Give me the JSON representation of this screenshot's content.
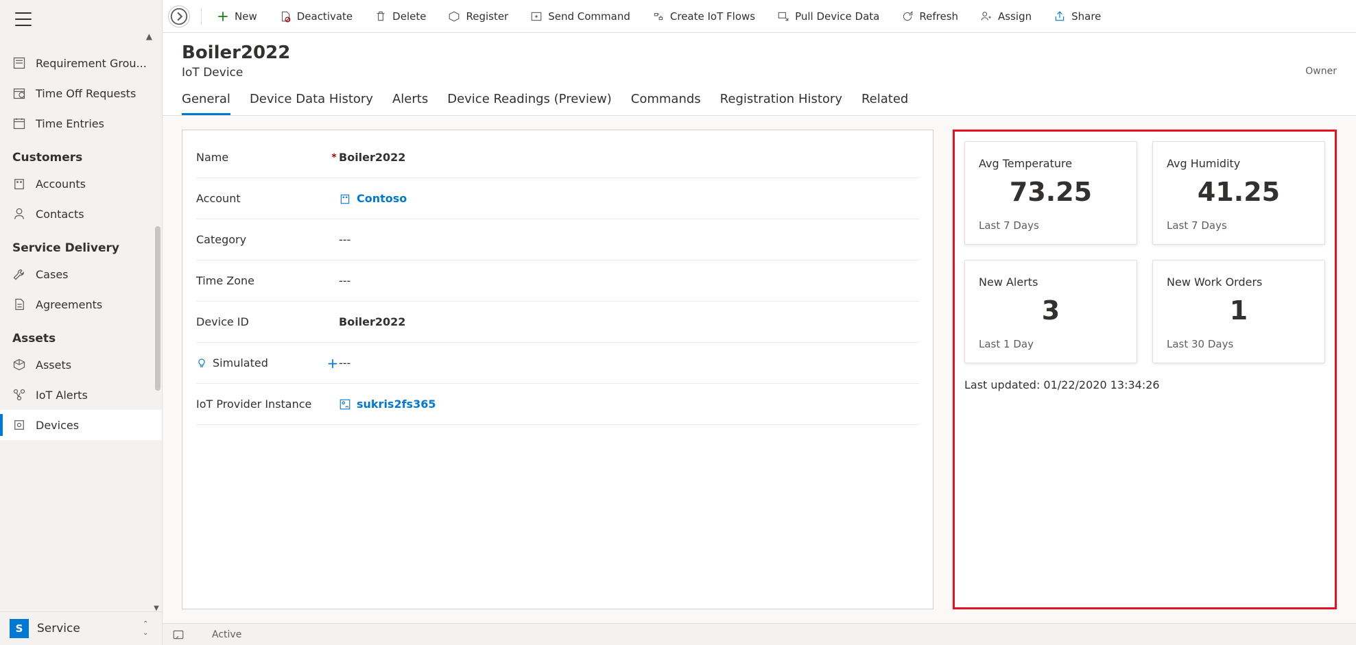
{
  "sidebar": {
    "items_top": [
      {
        "label": "Requirement Grou...",
        "icon": "form-icon"
      },
      {
        "label": "Time Off Requests",
        "icon": "clock-icon"
      },
      {
        "label": "Time Entries",
        "icon": "calendar-icon"
      }
    ],
    "groups": [
      {
        "label": "Customers",
        "items": [
          {
            "label": "Accounts",
            "icon": "building-icon"
          },
          {
            "label": "Contacts",
            "icon": "person-icon"
          }
        ]
      },
      {
        "label": "Service Delivery",
        "items": [
          {
            "label": "Cases",
            "icon": "wrench-icon"
          },
          {
            "label": "Agreements",
            "icon": "document-icon"
          }
        ]
      },
      {
        "label": "Assets",
        "items": [
          {
            "label": "Assets",
            "icon": "cube-icon"
          },
          {
            "label": "IoT Alerts",
            "icon": "alert-icon"
          },
          {
            "label": "Devices",
            "icon": "device-icon",
            "active": true
          }
        ]
      }
    ],
    "footer": {
      "badge": "S",
      "label": "Service"
    }
  },
  "commands": [
    {
      "label": "New",
      "icon": "plus-icon",
      "color": "#107c10"
    },
    {
      "label": "Deactivate",
      "icon": "deactivate-icon"
    },
    {
      "label": "Delete",
      "icon": "trash-icon"
    },
    {
      "label": "Register",
      "icon": "register-icon"
    },
    {
      "label": "Send Command",
      "icon": "send-icon"
    },
    {
      "label": "Create IoT Flows",
      "icon": "flow-icon"
    },
    {
      "label": "Pull Device Data",
      "icon": "pull-icon"
    },
    {
      "label": "Refresh",
      "icon": "refresh-icon"
    },
    {
      "label": "Assign",
      "icon": "assign-icon"
    },
    {
      "label": "Share",
      "icon": "share-icon"
    }
  ],
  "header": {
    "title": "Boiler2022",
    "subtitle": "IoT Device",
    "owner": "Owner"
  },
  "tabs": [
    "General",
    "Device Data History",
    "Alerts",
    "Device Readings (Preview)",
    "Commands",
    "Registration History",
    "Related"
  ],
  "active_tab": 0,
  "form": [
    {
      "label": "Name",
      "value": "Boiler2022",
      "required": true
    },
    {
      "label": "Account",
      "value": "Contoso",
      "link": true,
      "icon": "building-icon"
    },
    {
      "label": "Category",
      "value": "---",
      "empty": true
    },
    {
      "label": "Time Zone",
      "value": "---",
      "empty": true
    },
    {
      "label": "Device ID",
      "value": "Boiler2022"
    },
    {
      "label": "Simulated",
      "value": "---",
      "empty": true,
      "bulb": true,
      "lock": true
    },
    {
      "label": "IoT Provider Instance",
      "value": "sukris2fs365",
      "link": true,
      "icon": "provider-icon"
    }
  ],
  "cards": [
    {
      "title": "Avg Temperature",
      "value": "73.25",
      "sub": "Last 7 Days"
    },
    {
      "title": "Avg Humidity",
      "value": "41.25",
      "sub": "Last 7 Days"
    },
    {
      "title": "New Alerts",
      "value": "3",
      "sub": "Last 1 Day"
    },
    {
      "title": "New Work Orders",
      "value": "1",
      "sub": "Last 30 Days"
    }
  ],
  "last_updated": "Last updated: 01/22/2020 13:34:26",
  "status": {
    "state": "Active"
  }
}
